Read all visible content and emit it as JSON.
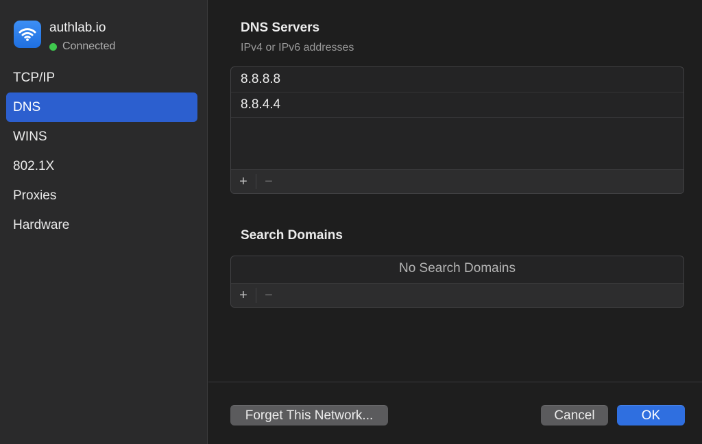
{
  "network": {
    "name": "authlab.io",
    "status": "Connected",
    "icon": "wifi-icon",
    "status_color": "#3fc94e"
  },
  "sidebar": {
    "items": [
      {
        "label": "TCP/IP",
        "active": false
      },
      {
        "label": "DNS",
        "active": true
      },
      {
        "label": "WINS",
        "active": false
      },
      {
        "label": "802.1X",
        "active": false
      },
      {
        "label": "Proxies",
        "active": false
      },
      {
        "label": "Hardware",
        "active": false
      }
    ]
  },
  "dns": {
    "title": "DNS Servers",
    "subtitle": "IPv4 or IPv6 addresses",
    "servers": [
      "8.8.8.8",
      "8.8.4.4"
    ],
    "add_label": "+",
    "remove_label": "−"
  },
  "search_domains": {
    "title": "Search Domains",
    "empty_text": "No Search Domains",
    "add_label": "+",
    "remove_label": "−"
  },
  "buttons": {
    "forget": "Forget This Network...",
    "cancel": "Cancel",
    "ok": "OK"
  },
  "colors": {
    "accent": "#2c5fcf",
    "primary_button": "#2f6fe0"
  }
}
